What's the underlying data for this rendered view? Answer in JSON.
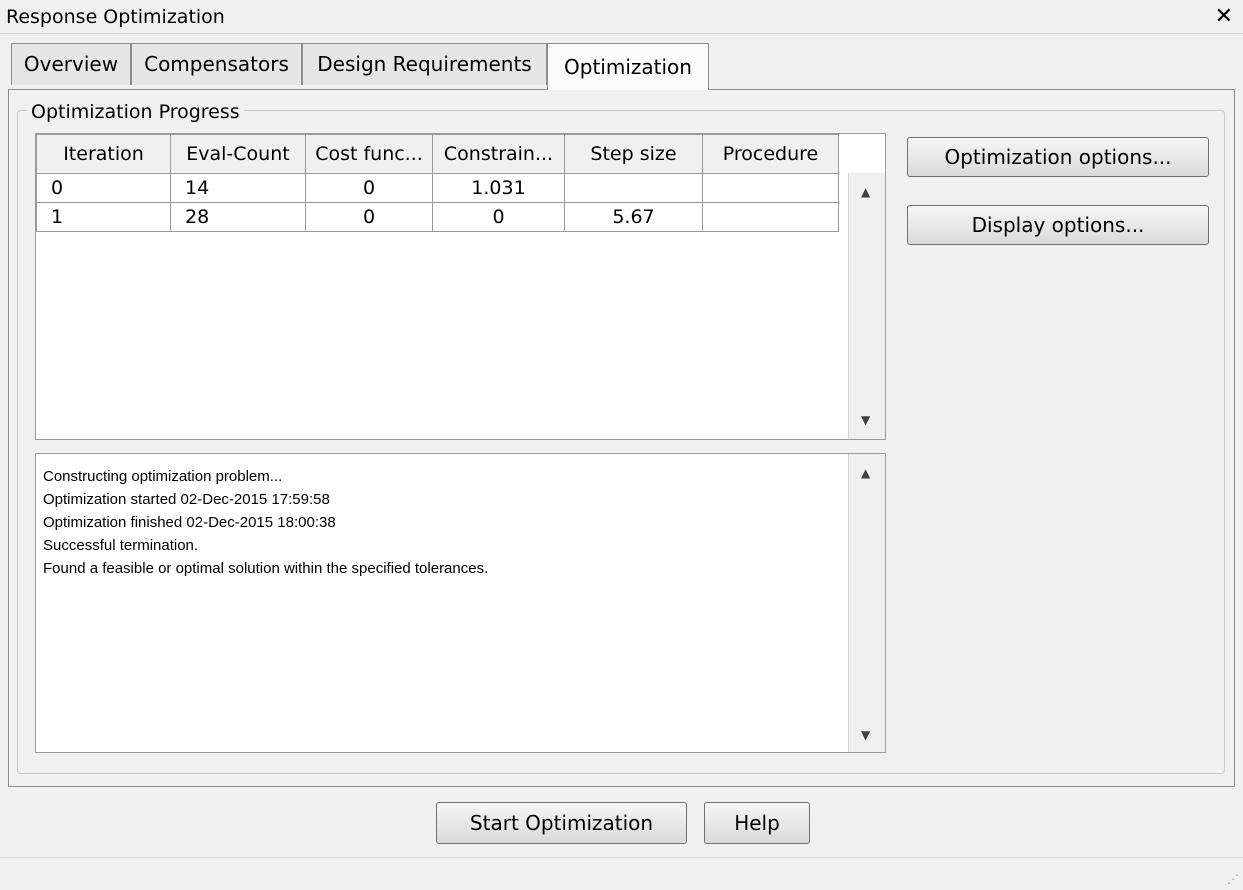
{
  "window": {
    "title": "Response Optimization",
    "close_glyph": "✕"
  },
  "tabs": [
    {
      "label": "Overview",
      "active": false
    },
    {
      "label": "Compensators",
      "active": false
    },
    {
      "label": "Design Requirements",
      "active": false
    },
    {
      "label": "Optimization",
      "active": true
    }
  ],
  "progress": {
    "group_label": "Optimization Progress",
    "columns": [
      "Iteration",
      "Eval-Count",
      "Cost func...",
      "Constrain...",
      "Step size",
      "Procedure"
    ],
    "rows": [
      [
        "0",
        "14",
        "0",
        "1.031",
        "",
        ""
      ],
      [
        "1",
        "28",
        "0",
        "0",
        "5.67",
        ""
      ]
    ]
  },
  "log": [
    "Constructing optimization problem...",
    "Optimization started 02-Dec-2015 17:59:58",
    "Optimization finished 02-Dec-2015 18:00:38",
    "Successful termination.",
    "Found a feasible or optimal solution within the specified tolerances."
  ],
  "side_buttons": {
    "optimization_options": "Optimization options...",
    "display_options": "Display options..."
  },
  "bottom_buttons": {
    "start": "Start Optimization",
    "help": "Help"
  },
  "icons": {
    "scroll_up": "▲",
    "scroll_down": "▼",
    "resize_grip": "⋰"
  }
}
